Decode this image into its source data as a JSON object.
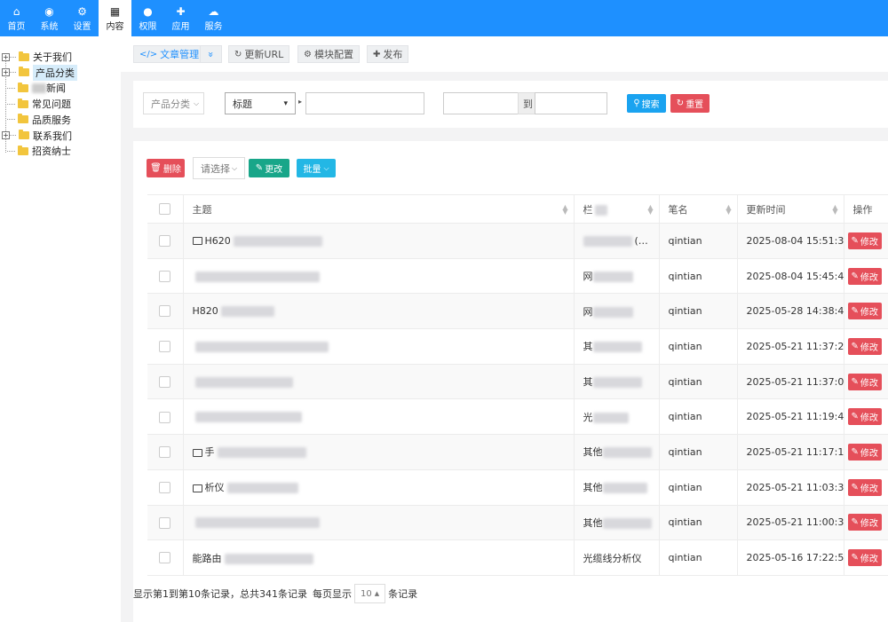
{
  "topnav": [
    {
      "icon": "⌂",
      "label": "首页",
      "name": "home"
    },
    {
      "icon": "◉",
      "label": "系统",
      "name": "system"
    },
    {
      "icon": "⚙",
      "label": "设置",
      "name": "settings"
    },
    {
      "icon": "▦",
      "label": "内容",
      "name": "content",
      "active": true
    },
    {
      "icon": "●",
      "label": "权限",
      "name": "permission"
    },
    {
      "icon": "✚",
      "label": "应用",
      "name": "apps"
    },
    {
      "icon": "☁",
      "label": "服务",
      "name": "service"
    }
  ],
  "tree": [
    {
      "label": "关于我们",
      "toggle": "+"
    },
    {
      "label": "产品分类",
      "toggle": "+",
      "selected": true
    },
    {
      "label": "新闻",
      "blurred_prefix": true
    },
    {
      "label": "常见问题"
    },
    {
      "label": "品质服务"
    },
    {
      "label": "联系我们",
      "toggle": "+"
    },
    {
      "label": "招资纳士"
    }
  ],
  "toolbar": {
    "article_manage": "文章管理",
    "expand": "»",
    "update_url": "更新URL",
    "module_config": "模块配置",
    "publish": "发布"
  },
  "search": {
    "category_select": "产品分类",
    "field_select": "标题",
    "range_to": "到",
    "search_button": "搜索",
    "reset_button": "重置"
  },
  "actions": {
    "delete": "删除",
    "select_placeholder": "请选择",
    "modify": "更改",
    "batch": "批量"
  },
  "table": {
    "headers": {
      "subject": "主题",
      "column": "栏",
      "author": "笔名",
      "updated": "更新时间",
      "ops": "操作"
    },
    "edit_label": "修改",
    "rows": [
      {
        "subject": "H620",
        "column": "(…",
        "author": "qintian",
        "updated": "2025-08-04 15:51:38",
        "img": true
      },
      {
        "subject": "",
        "column": "网",
        "author": "qintian",
        "updated": "2025-08-04 15:45:44"
      },
      {
        "subject": "H820",
        "column": "网",
        "author": "qintian",
        "updated": "2025-05-28 14:38:46"
      },
      {
        "subject": "",
        "column": "其",
        "author": "qintian",
        "updated": "2025-05-21 11:37:23"
      },
      {
        "subject": "",
        "column": "其",
        "author": "qintian",
        "updated": "2025-05-21 11:37:06"
      },
      {
        "subject": "",
        "column": "光",
        "author": "qintian",
        "updated": "2025-05-21 11:19:48"
      },
      {
        "subject": "手",
        "column": "其他",
        "author": "qintian",
        "updated": "2025-05-21 11:17:16",
        "img": true
      },
      {
        "subject": "析仪",
        "column": "其他",
        "author": "qintian",
        "updated": "2025-05-21 11:03:32",
        "img": true
      },
      {
        "subject": "",
        "column": "其他",
        "author": "qintian",
        "updated": "2025-05-21 11:00:30"
      },
      {
        "subject": "能路由",
        "column": "光缆线分析仪",
        "author": "qintian",
        "updated": "2025-05-16 17:22:59"
      }
    ]
  },
  "pagination": {
    "summary": "显示第1到第10条记录，总共341条记录",
    "per_page_prefix": "每页显示",
    "per_page_value": "10",
    "per_page_suffix": "条记录"
  },
  "colors": {
    "topbar": "#1e90ff",
    "danger": "#e54f5a",
    "success": "#18a689",
    "info": "#23b7e5"
  }
}
